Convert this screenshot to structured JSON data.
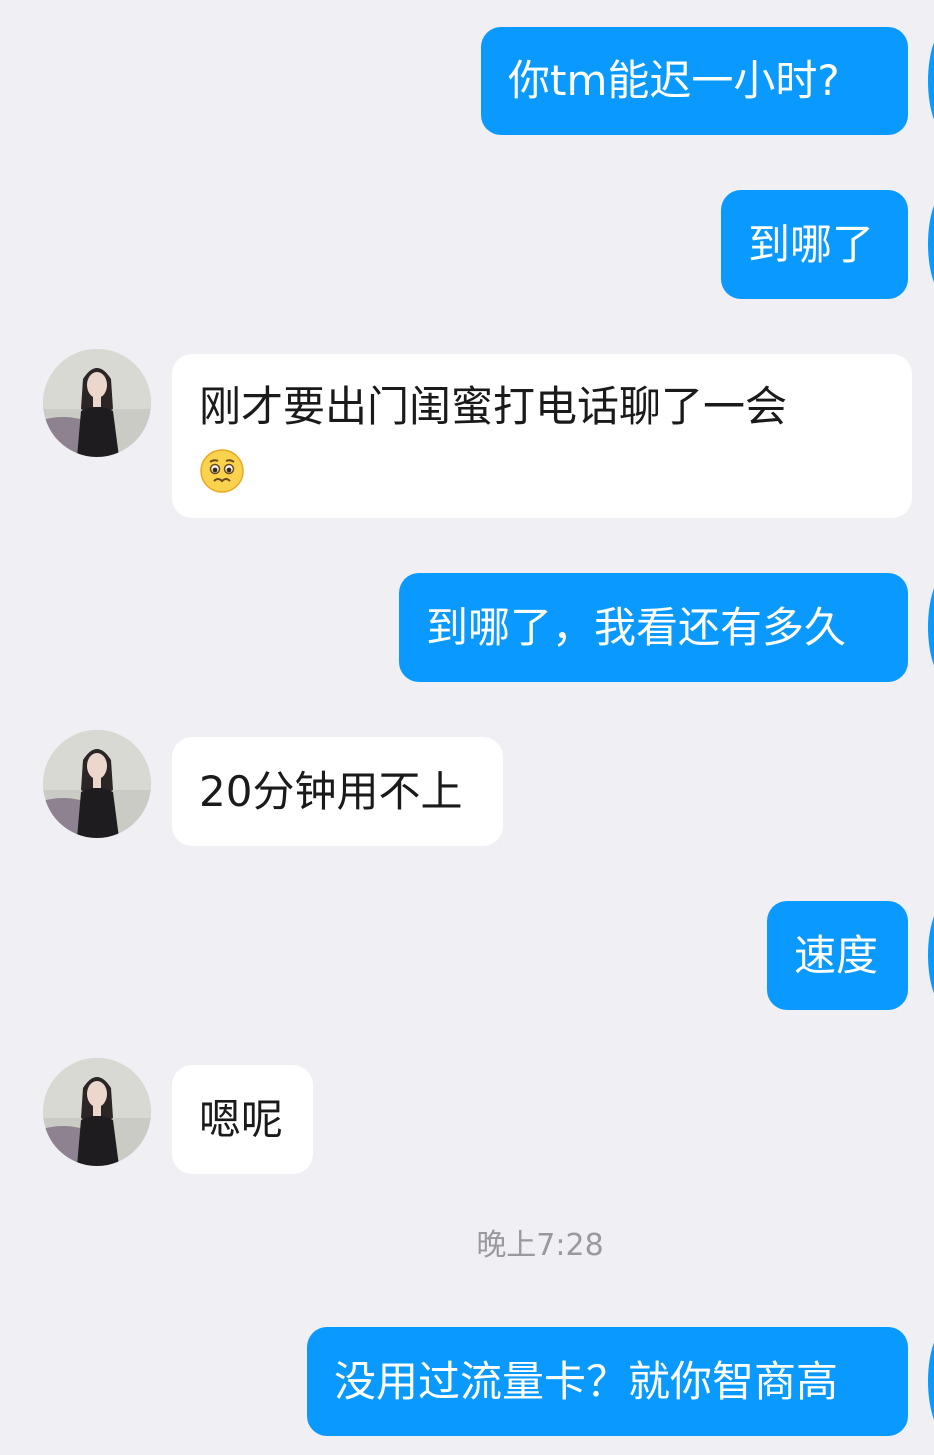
{
  "messages": [
    {
      "id": "m1",
      "direction": "out",
      "text": "你tm能迟一小时?"
    },
    {
      "id": "m2",
      "direction": "out",
      "text": "到哪了"
    },
    {
      "id": "m3",
      "direction": "in",
      "text": "刚才要出门闺蜜打电话聊了一会",
      "emoji": "pleading-face-icon"
    },
    {
      "id": "m4",
      "direction": "out",
      "text": "到哪了，我看还有多久"
    },
    {
      "id": "m5",
      "direction": "in",
      "text": "20分钟用不上"
    },
    {
      "id": "m6",
      "direction": "out",
      "text": "速度"
    },
    {
      "id": "m7",
      "direction": "in",
      "text": "嗯呢"
    },
    {
      "id": "m9",
      "direction": "out",
      "text": "没用过流量卡？就你智商高"
    }
  ],
  "timestamp": "晚上7:28",
  "colors": {
    "background": "#efeff4",
    "outgoing_bubble": "#0a99ff",
    "incoming_bubble": "#ffffff",
    "incoming_text": "#1a1a1a",
    "timestamp_text": "#9a9a9e"
  }
}
